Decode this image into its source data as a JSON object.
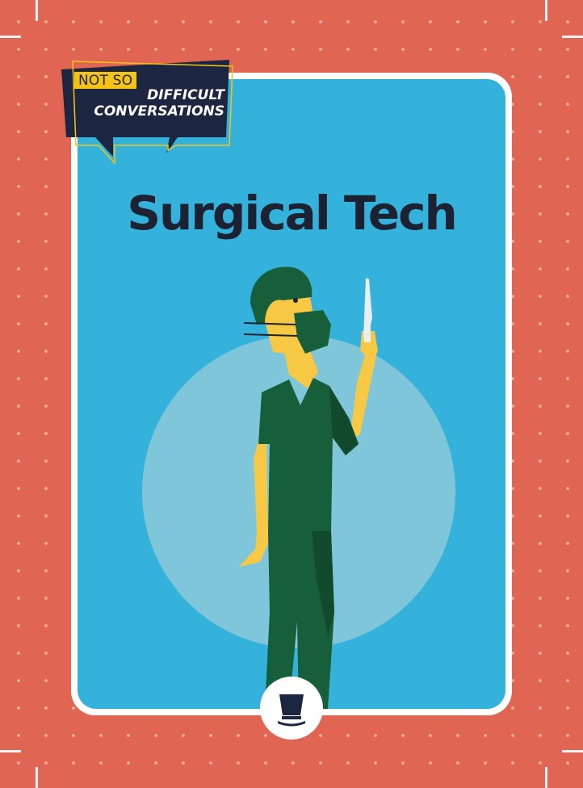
{
  "badge": {
    "top": "NOT SO",
    "line1": "DIFFICULT",
    "line2": "CONVERSATIONS"
  },
  "card": {
    "title": "Surgical Tech"
  },
  "colors": {
    "background": "#E06552",
    "card_panel": "#35B2DC",
    "circle": "#80C6DA",
    "scrubs": "#175E3A",
    "skin": "#F7C843",
    "title_text": "#1C2232",
    "badge_fill": "#1C2640",
    "badge_accent": "#F5C315"
  },
  "icons": {
    "brand_logo": "top-hat-icon",
    "illustration": "surgical-tech-illustration"
  }
}
